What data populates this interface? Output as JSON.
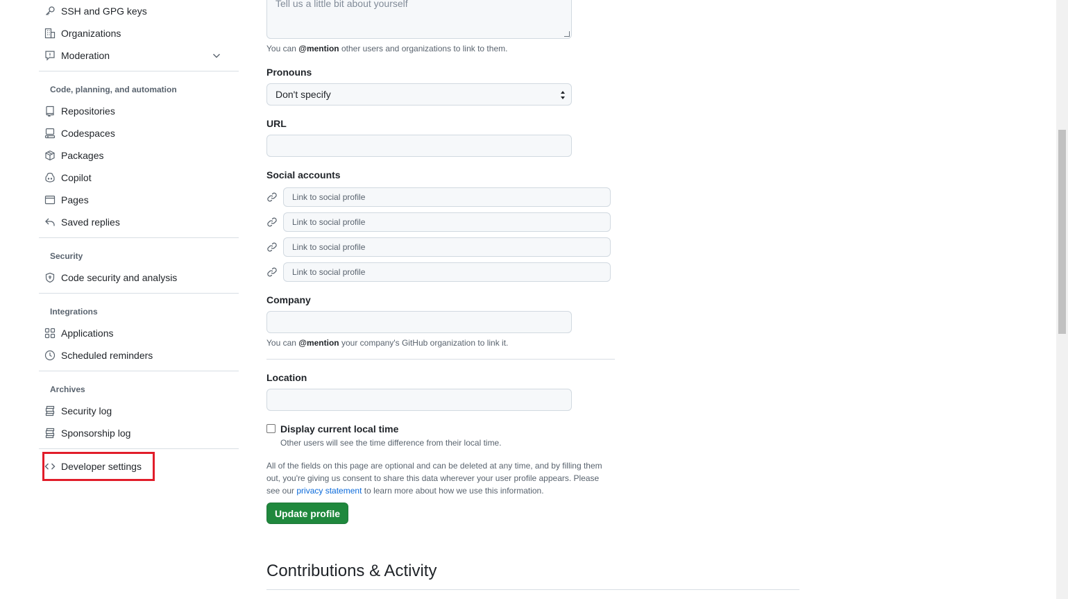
{
  "sidebar": {
    "top_items": [
      {
        "label": "SSH and GPG keys",
        "icon": "key-icon"
      },
      {
        "label": "Organizations",
        "icon": "organization-icon"
      },
      {
        "label": "Moderation",
        "icon": "report-icon"
      }
    ],
    "code_section": {
      "title": "Code, planning, and automation",
      "items": [
        {
          "label": "Repositories",
          "icon": "repo-icon"
        },
        {
          "label": "Codespaces",
          "icon": "codespaces-icon"
        },
        {
          "label": "Packages",
          "icon": "package-icon"
        },
        {
          "label": "Copilot",
          "icon": "copilot-icon"
        },
        {
          "label": "Pages",
          "icon": "browser-icon"
        },
        {
          "label": "Saved replies",
          "icon": "reply-icon"
        }
      ]
    },
    "security_section": {
      "title": "Security",
      "items": [
        {
          "label": "Code security and analysis",
          "icon": "shield-lock-icon"
        }
      ]
    },
    "integrations_section": {
      "title": "Integrations",
      "items": [
        {
          "label": "Applications",
          "icon": "apps-icon"
        },
        {
          "label": "Scheduled reminders",
          "icon": "clock-icon"
        }
      ]
    },
    "archives_section": {
      "title": "Archives",
      "items": [
        {
          "label": "Security log",
          "icon": "log-icon"
        },
        {
          "label": "Sponsorship log",
          "icon": "log-icon"
        }
      ]
    },
    "developer": {
      "label": "Developer settings",
      "icon": "code-icon"
    }
  },
  "form": {
    "bio_placeholder": "Tell us a little bit about yourself",
    "bio_note_prefix": "You can ",
    "bio_note_mention": "@mention",
    "bio_note_suffix": " other users and organizations to link to them.",
    "pronouns_label": "Pronouns",
    "pronouns_value": "Don't specify",
    "url_label": "URL",
    "url_value": "",
    "social_label": "Social accounts",
    "social_placeholder": "Link to social profile",
    "company_label": "Company",
    "company_value": "",
    "company_note_prefix": "You can ",
    "company_note_mention": "@mention",
    "company_note_suffix": " your company's GitHub organization to link it.",
    "location_label": "Location",
    "location_value": "",
    "local_time_label": "Display current local time",
    "local_time_checked": false,
    "local_time_note": "Other users will see the time difference from their local time.",
    "disclaimer_prefix": "All of the fields on this page are optional and can be deleted at any time, and by filling them out, you're giving us consent to share this data wherever your user profile appears. Please see our ",
    "disclaimer_link": "privacy statement",
    "disclaimer_suffix": " to learn more about how we use this information.",
    "submit_label": "Update profile"
  },
  "contributions": {
    "title": "Contributions & Activity"
  },
  "colors": {
    "primary_button": "#1f883d",
    "link": "#0969da",
    "highlight": "#e11d2a"
  }
}
